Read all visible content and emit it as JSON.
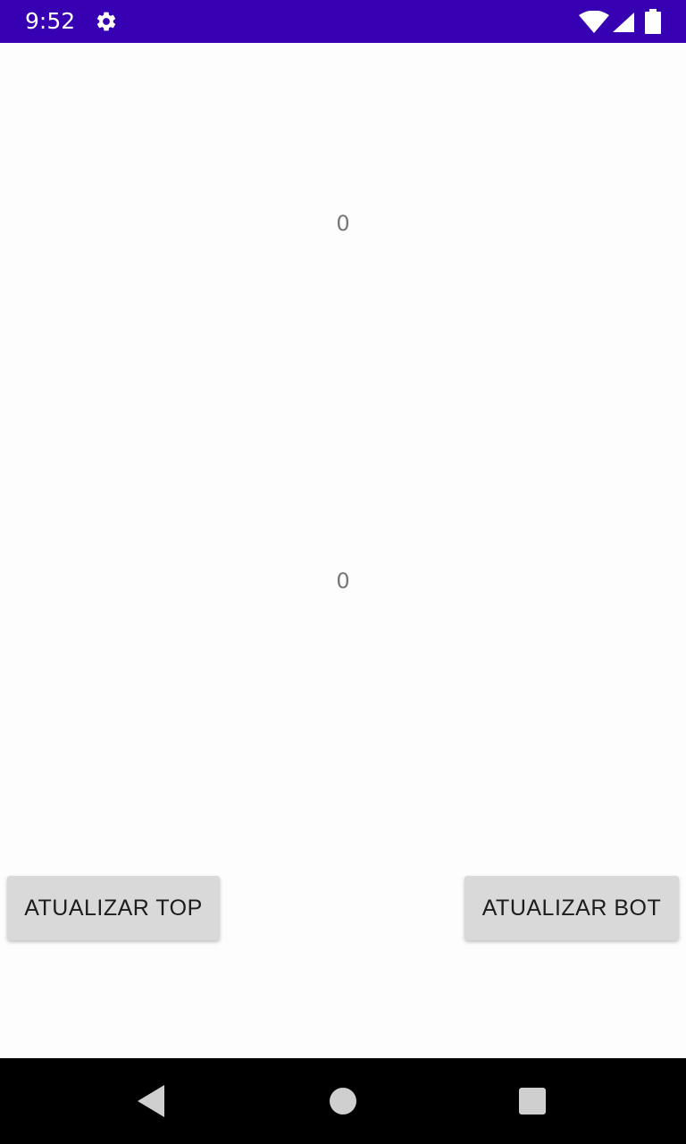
{
  "status_bar": {
    "time": "9:52",
    "background_color": "#3701b3",
    "icons": [
      "gear-icon",
      "wifi-icon",
      "signal-icon",
      "battery-icon"
    ]
  },
  "main": {
    "top_counter": "0",
    "bottom_counter": "0"
  },
  "buttons": {
    "update_top_label": "ATUALIZAR TOP",
    "update_bot_label": "ATUALIZAR BOT"
  },
  "nav_bar": {
    "icons": [
      "back-icon",
      "home-icon",
      "recents-icon"
    ]
  }
}
